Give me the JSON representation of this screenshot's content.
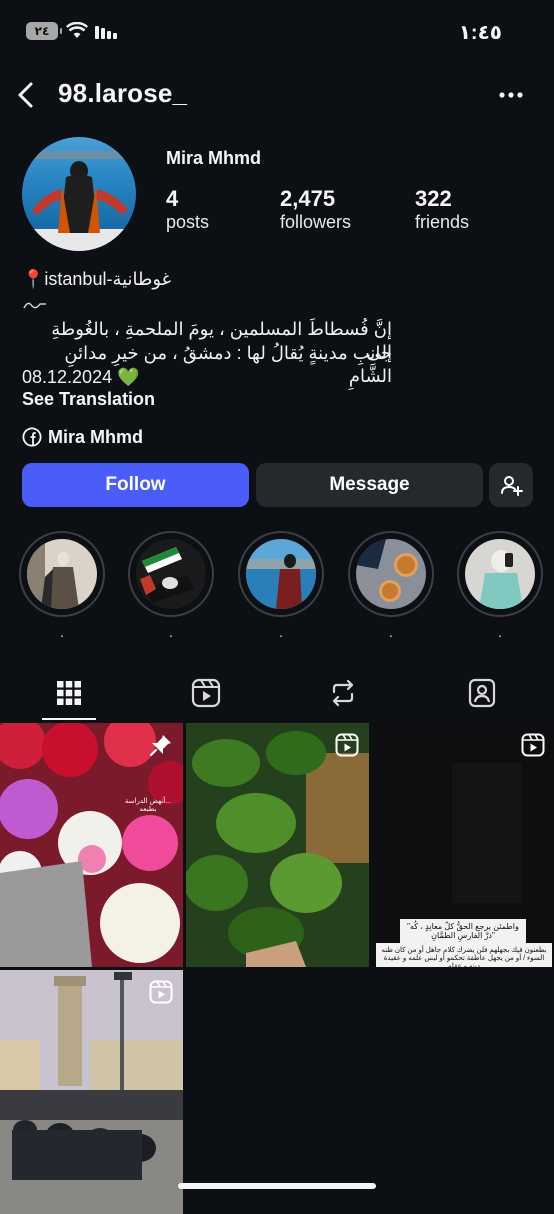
{
  "status_bar": {
    "time": "١:٤٥",
    "battery": "٢٤"
  },
  "header": {
    "username": "98.larose_",
    "back_icon": "chevron-left-icon",
    "more_icon": "more-horizontal-icon"
  },
  "profile": {
    "full_name": "Mira Mhmd",
    "stats": [
      {
        "value": "4",
        "label": "posts"
      },
      {
        "value": "2,475",
        "label": "followers"
      },
      {
        "value": "322",
        "label": "friends"
      }
    ],
    "location": "📍istanbul-غوطانية",
    "bio_line1": "إنَّ فُسطاطَ المسلمين ، يومَ الملحمةِ ، بالغُوطةِ إلى",
    "bio_line2": "جانبِ مدينةٍ يُقالُ لها : دمشقُ ، من خيرِ مدائنِ الشَّامِ",
    "bio_date": "08.12.2024 💚",
    "see_translation": "See Translation",
    "facebook_name": "Mira Mhmd"
  },
  "actions": {
    "follow": "Follow",
    "message": "Message",
    "add_user_icon": "add-person-icon"
  },
  "highlights": [
    {
      "label": "."
    },
    {
      "label": "."
    },
    {
      "label": "."
    },
    {
      "label": "."
    },
    {
      "label": "."
    }
  ],
  "tabs": [
    {
      "icon": "grid-icon",
      "active": true
    },
    {
      "icon": "reels-icon",
      "active": false
    },
    {
      "icon": "reposts-icon",
      "active": false
    },
    {
      "icon": "tagged-icon",
      "active": false
    }
  ],
  "posts": [
    {
      "badge": "pin-icon",
      "overlay_text": "...أنهض الدراسة بطبعه"
    },
    {
      "badge": "reel-icon",
      "overlay_text": ""
    },
    {
      "badge": "reel-icon",
      "caption1": "\"واطمئن يرجع الحقُّ كلّ معانِدٍ ، كُه درَّ الفارسِ الطمَّانِ\"",
      "caption2": "بطعنون فيك بجهلهم فلن يضرك كلام جاهل أو من كان ظنه السوء / أو من يجهل عاطفة تحكمو أو ليس علمه و عقيدة دينه و عقله"
    },
    {
      "badge": "reel-icon",
      "overlay_text": ""
    }
  ],
  "colors": {
    "background": "#0c1014",
    "follow_button": "#4a5df9",
    "secondary_button": "#25292e",
    "heart": "#3cc65a"
  }
}
